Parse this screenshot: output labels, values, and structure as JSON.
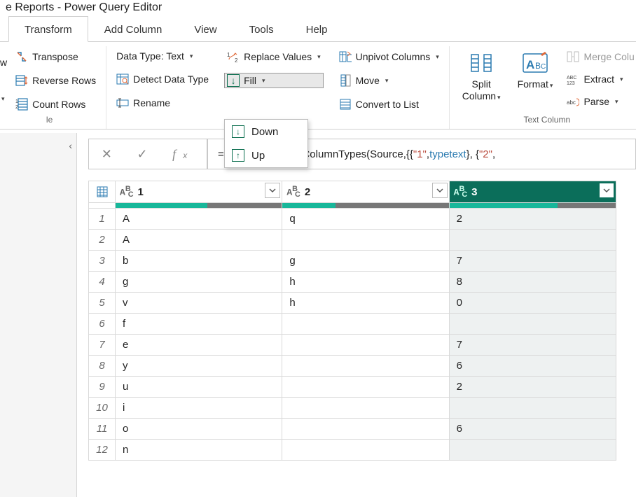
{
  "window": {
    "title_fragment": "e Reports - Power Query Editor"
  },
  "tabs": {
    "items": [
      "Transform",
      "Add Column",
      "View",
      "Tools",
      "Help"
    ],
    "active_index": 0
  },
  "ribbon": {
    "table": {
      "transpose": "Transpose",
      "reverse_rows": "Reverse Rows",
      "count_rows": "Count Rows",
      "group_label_fragment": "le",
      "w_fragment": "w"
    },
    "anycol": {
      "data_type_label": "Data Type: Text",
      "detect": "Detect Data Type",
      "rename": "Rename",
      "replace": "Replace Values",
      "fill": "Fill",
      "unpivot": "Unpivot Columns",
      "move": "Move",
      "convert": "Convert to List"
    },
    "split": {
      "label": "Split",
      "label2": "Column"
    },
    "format": {
      "label": "Format"
    },
    "textcol": {
      "merge": "Merge Colu",
      "extract": "Extract",
      "parse": "Parse",
      "group_label": "Text Column"
    }
  },
  "fill_menu": {
    "down": "Down",
    "up": "Up"
  },
  "formula": {
    "prefix": "= Table.TransformColumnTypes(Source,{{",
    "s1": "\"1\"",
    "mid1": ", ",
    "kw1": "type",
    "sp1": " ",
    "kw2": "text",
    "mid2": "}, {",
    "s2": "\"2\"",
    "tail": ","
  },
  "columns": [
    {
      "name": "1",
      "type_icon": "ABC",
      "selected": false,
      "bar_green": 0.55
    },
    {
      "name": "2",
      "type_icon": "ABC",
      "selected": false,
      "bar_green": 0.32
    },
    {
      "name": "3",
      "type_icon": "ABC",
      "selected": true,
      "bar_green": 0.65
    }
  ],
  "rows": [
    {
      "n": 1,
      "c1": "A",
      "c2": "q",
      "c3": "2"
    },
    {
      "n": 2,
      "c1": "A",
      "c2": "",
      "c3": ""
    },
    {
      "n": 3,
      "c1": "b",
      "c2": "g",
      "c3": "7"
    },
    {
      "n": 4,
      "c1": "g",
      "c2": "h",
      "c3": "8"
    },
    {
      "n": 5,
      "c1": "v",
      "c2": "h",
      "c3": "0"
    },
    {
      "n": 6,
      "c1": "f",
      "c2": "",
      "c3": ""
    },
    {
      "n": 7,
      "c1": "e",
      "c2": "",
      "c3": "7"
    },
    {
      "n": 8,
      "c1": "y",
      "c2": "",
      "c3": "6"
    },
    {
      "n": 9,
      "c1": "u",
      "c2": "",
      "c3": "2"
    },
    {
      "n": 10,
      "c1": "i",
      "c2": "",
      "c3": ""
    },
    {
      "n": 11,
      "c1": "o",
      "c2": "",
      "c3": "6"
    },
    {
      "n": 12,
      "c1": "n",
      "c2": "",
      "c3": ""
    }
  ]
}
